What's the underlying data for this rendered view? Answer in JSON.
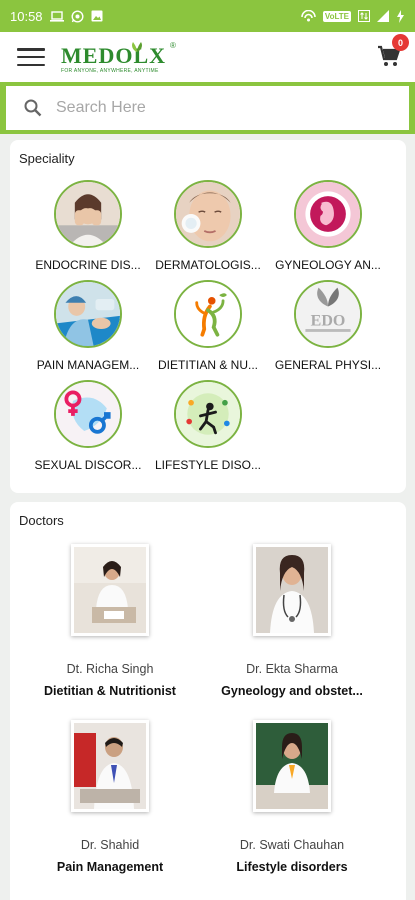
{
  "status_bar": {
    "time": "10:58",
    "volte": "VoLTE"
  },
  "app_bar": {
    "logo_text": "MEDOLX",
    "logo_reg": "®",
    "logo_tagline": "FOR ANYONE, ANYWHERE, ANYTIME",
    "cart_count": "0"
  },
  "search": {
    "placeholder": "Search Here"
  },
  "speciality": {
    "title": "Speciality",
    "items": [
      {
        "label": "ENDOCRINE DIS...",
        "icon": "endocrine-icon"
      },
      {
        "label": "DERMATOLOGIS...",
        "icon": "dermatology-icon"
      },
      {
        "label": "GYNEOLOGY AN...",
        "icon": "gynecology-icon"
      },
      {
        "label": "PAIN MANAGEM...",
        "icon": "pain-management-icon"
      },
      {
        "label": "DIETITIAN & NU...",
        "icon": "dietitian-icon"
      },
      {
        "label": "GENERAL PHYSI...",
        "icon": "general-physician-icon"
      },
      {
        "label": "SEXUAL DISCOR...",
        "icon": "sexual-disorder-icon"
      },
      {
        "label": "LIFESTYLE DISO...",
        "icon": "lifestyle-icon"
      }
    ]
  },
  "doctors": {
    "title": "Doctors",
    "items": [
      {
        "name": "Dt. Richa Singh",
        "speciality": "Dietitian & Nutritionist"
      },
      {
        "name": "Dr. Ekta Sharma",
        "speciality": "Gyneology and obstet..."
      },
      {
        "name": "Dr. Shahid",
        "speciality": "Pain Management"
      },
      {
        "name": "Dr. Swati Chauhan",
        "speciality": "Lifestyle disorders"
      }
    ]
  },
  "colors": {
    "brand_green": "#8bc53f",
    "logo_green": "#2e8b2e",
    "badge_red": "#e53935"
  }
}
